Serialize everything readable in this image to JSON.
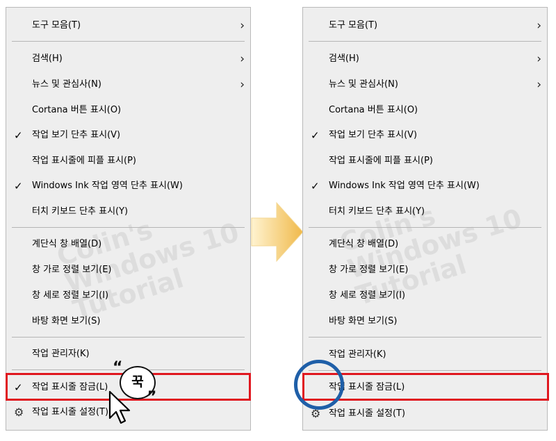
{
  "left_menu": {
    "items": {
      "toolbar": "도구 모음(T)",
      "search": "검색(H)",
      "news": "뉴스 및 관심사(N)",
      "cortana": "Cortana 버튼 표시(O)",
      "task_view": "작업 보기 단추 표시(V)",
      "people": "작업 표시줄에 피플 표시(P)",
      "ink": "Windows Ink 작업 영역 단추 표시(W)",
      "touch": "터치 키보드 단추 표시(Y)",
      "cascade": "계단식 창 배열(D)",
      "stacked": "창 가로 정렬 보기(E)",
      "side_by_side": "창 세로 정렬 보기(I)",
      "desktop": "바탕 화면 보기(S)",
      "task_manager": "작업 관리자(K)",
      "lock": "작업 표시줄 잠금(L)",
      "settings": "작업 표시줄 설정(T)"
    }
  },
  "right_menu": {
    "items": {
      "toolbar": "도구 모음(T)",
      "search": "검색(H)",
      "news": "뉴스 및 관심사(N)",
      "cortana": "Cortana 버튼 표시(O)",
      "task_view": "작업 보기 단추 표시(V)",
      "people": "작업 표시줄에 피플 표시(P)",
      "ink": "Windows Ink 작업 영역 단추 표시(W)",
      "touch": "터치 키보드 단추 표시(Y)",
      "cascade": "계단식 창 배열(D)",
      "stacked": "창 가로 정렬 보기(E)",
      "side_by_side": "창 세로 정렬 보기(I)",
      "desktop": "바탕 화면 보기(S)",
      "task_manager": "작업 관리자(K)",
      "lock": "작업 표시줄 잠금(L)",
      "settings": "작업 표시줄 설정(T)"
    }
  },
  "symbols": {
    "check": "✓",
    "arrow": "›",
    "gear": "⚙"
  },
  "annotation": {
    "bubble_text": "꾹",
    "quote_open": "“",
    "quote_close": "”"
  },
  "watermark": {
    "left": "Colin's\nWindows 10\nTutorial",
    "right": "Colin's\nWindows 10\nTutorial"
  },
  "colors": {
    "menu_bg": "#eeeeee",
    "highlight": "#e0171f",
    "circle": "#1f5fa8",
    "arrow_gradient_start": "#fff3d0",
    "arrow_gradient_end": "#f0b94a"
  }
}
